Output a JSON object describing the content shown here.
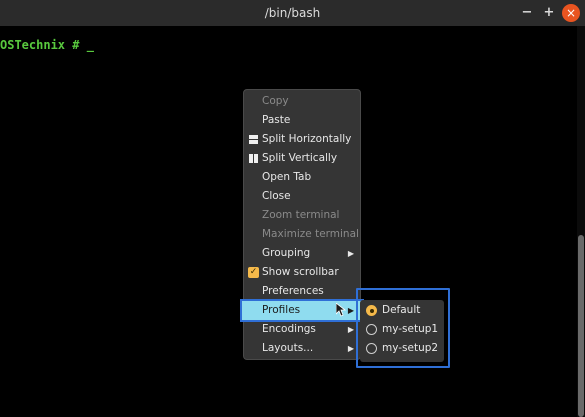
{
  "window": {
    "title": "/bin/bash",
    "minimize_label": "−",
    "maximize_label": "+",
    "close_label": "×"
  },
  "terminal": {
    "prompt": "OSTechnix # _"
  },
  "context_menu": {
    "items": [
      {
        "label": "Copy",
        "enabled": false
      },
      {
        "label": "Paste",
        "enabled": true
      },
      {
        "label": "Split Horizontally",
        "enabled": true,
        "icon": "split-horizontal-icon"
      },
      {
        "label": "Split Vertically",
        "enabled": true,
        "icon": "split-vertical-icon"
      },
      {
        "label": "Open Tab",
        "enabled": true
      },
      {
        "label": "Close",
        "enabled": true
      },
      {
        "label": "Zoom terminal",
        "enabled": false
      },
      {
        "label": "Maximize terminal",
        "enabled": false
      },
      {
        "label": "Grouping",
        "enabled": true,
        "submenu": true
      },
      {
        "label": "Show scrollbar",
        "enabled": true,
        "checked": true
      },
      {
        "label": "Preferences",
        "enabled": true
      },
      {
        "label": "Profiles",
        "enabled": true,
        "submenu": true,
        "highlighted": true
      },
      {
        "label": "Encodings",
        "enabled": true,
        "submenu": true
      },
      {
        "label": "Layouts...",
        "enabled": true,
        "submenu": true
      }
    ]
  },
  "profiles_submenu": {
    "items": [
      {
        "label": "Default",
        "selected": true
      },
      {
        "label": "my-setup1",
        "selected": false
      },
      {
        "label": "my-setup2",
        "selected": false
      }
    ]
  },
  "colors": {
    "accent": "#f5b94a",
    "highlight": "#8fdcef",
    "annotation_outline": "#2f6fd6",
    "prompt_green": "#59c93e",
    "close_button": "#e95420"
  },
  "icons": {
    "arrow": "▶",
    "check": "✓"
  }
}
